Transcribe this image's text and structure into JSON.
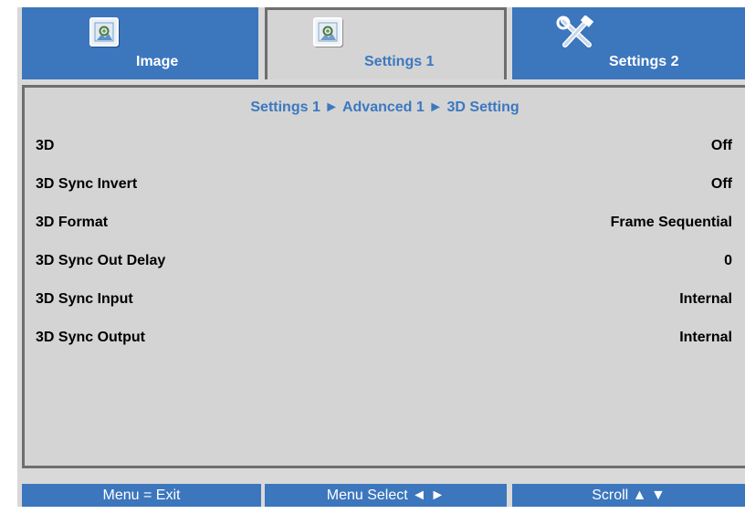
{
  "tabs": [
    {
      "label": "Image",
      "icon": "image-adjust-icon",
      "active": false
    },
    {
      "label": "Settings 1",
      "icon": "settings-panel-icon",
      "active": true
    },
    {
      "label": "Settings 2",
      "icon": "tools-icon",
      "active": false
    }
  ],
  "breadcrumb": "Settings 1 ► Advanced 1 ► 3D Setting",
  "settings": [
    {
      "label": "3D",
      "value": "Off"
    },
    {
      "label": "3D Sync Invert",
      "value": "Off"
    },
    {
      "label": "3D Format",
      "value": "Frame Sequential"
    },
    {
      "label": "3D Sync Out Delay",
      "value": "0"
    },
    {
      "label": "3D Sync Input",
      "value": "Internal"
    },
    {
      "label": "3D Sync Output",
      "value": "Internal"
    }
  ],
  "footer": {
    "exit": "Menu = Exit",
    "select": "Menu Select ◄ ►",
    "scroll": "Scroll ▲ ▼"
  },
  "colors": {
    "tab_blue": "#3c76bd",
    "accent_text": "#3b78c0",
    "panel_gray": "#d4d4d4",
    "border_gray": "#6e6e6e"
  }
}
